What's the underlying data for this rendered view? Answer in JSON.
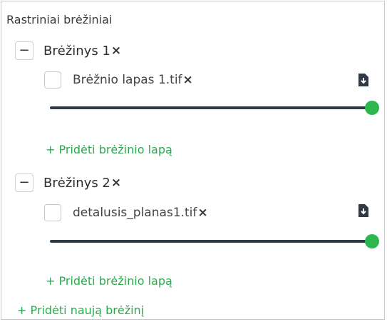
{
  "section_title": "Rastriniai brėžiniai",
  "accent_color": "#2db84f",
  "groups": [
    {
      "collapse_symbol": "−",
      "name": "Brėžinys 1",
      "remove_symbol": "×",
      "sheets": [
        {
          "file": "Brėžnio lapas 1.tif",
          "remove_symbol": "×",
          "icon": "download-document-icon",
          "opacity": 1.0
        }
      ],
      "add_sheet_label": "+ Pridėti brėžinio lapą"
    },
    {
      "collapse_symbol": "−",
      "name": "Brėžinys 2",
      "remove_symbol": "×",
      "sheets": [
        {
          "file": "detalusis_planas1.tif",
          "remove_symbol": "×",
          "icon": "download-document-icon",
          "opacity": 1.0
        }
      ],
      "add_sheet_label": "+ Pridėti brėžinio lapą"
    }
  ],
  "add_drawing_label": "+ Pridėti naują brėžinį"
}
